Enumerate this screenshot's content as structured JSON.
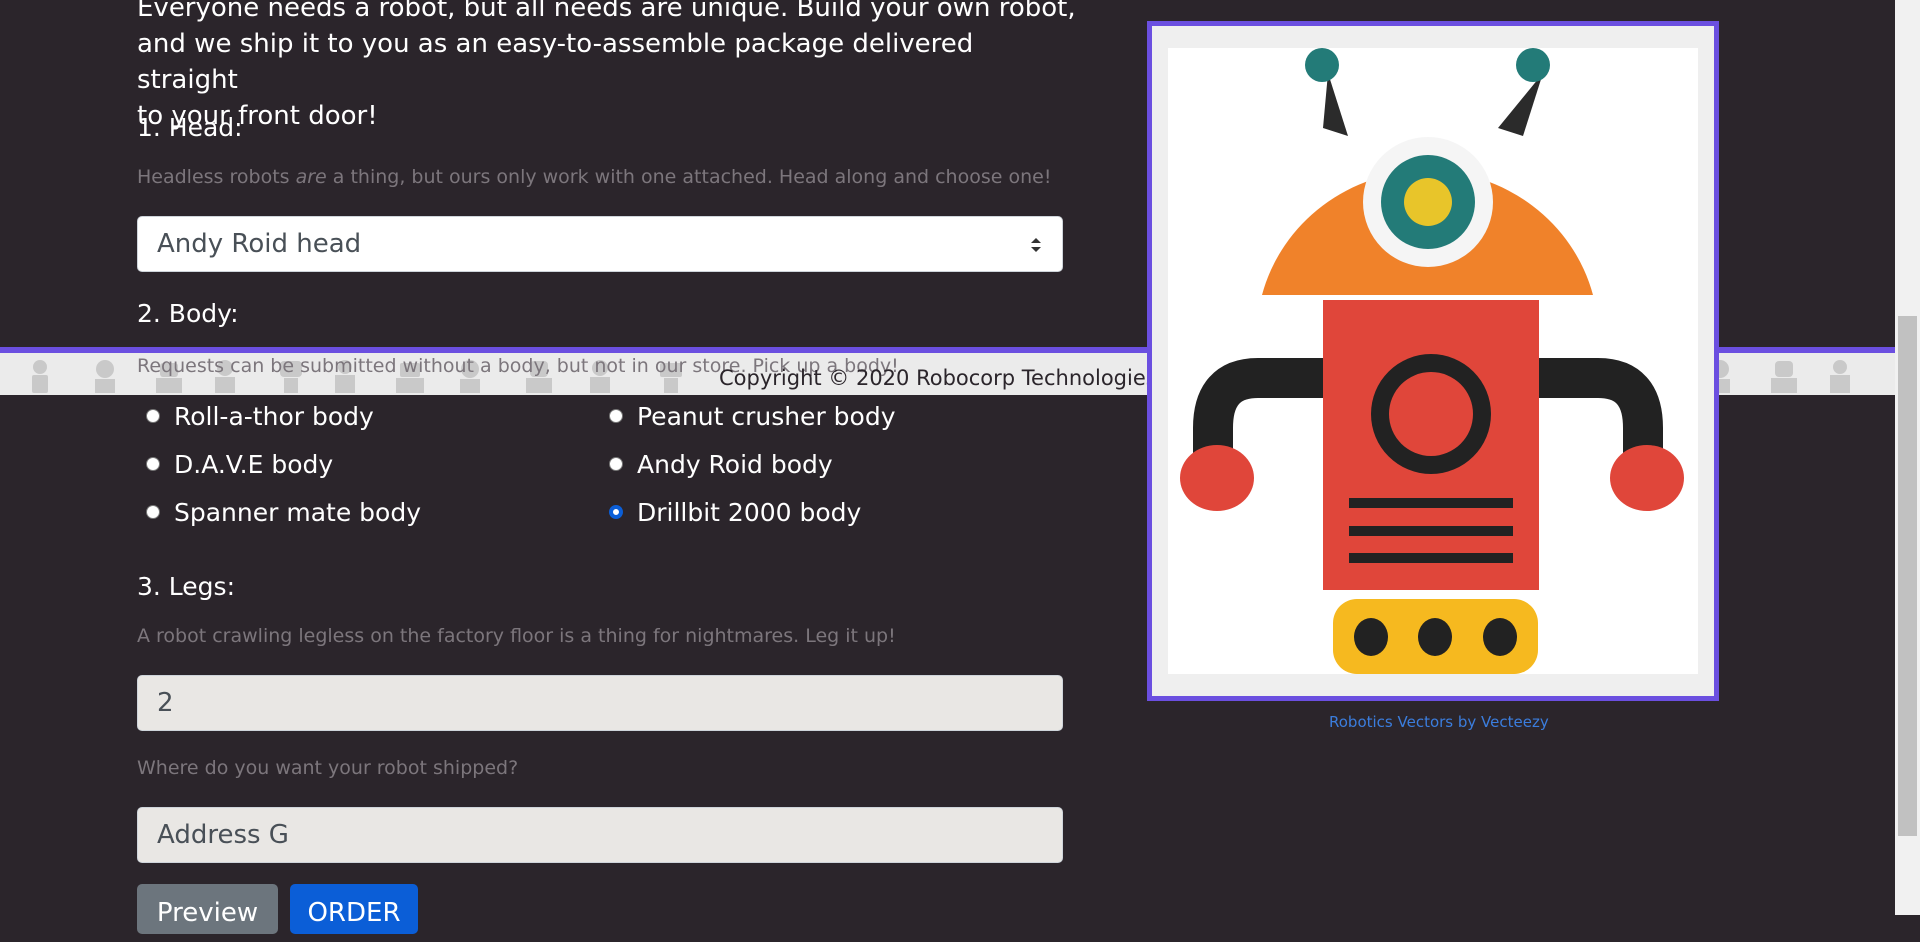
{
  "intro": {
    "line1": "Everyone needs a robot, but all needs are unique. Build your own robot,",
    "line2": "and we ship it to you as an easy-to-assemble package delivered straight",
    "line3": "to your front door!"
  },
  "head": {
    "heading": "1. Head:",
    "help_before": "Headless robots ",
    "help_em": "are",
    "help_after": " a thing, but ours only work with one attached. Head along and choose one!",
    "selected": "Andy Roid head"
  },
  "body": {
    "heading": "2. Body:",
    "help": "Requests can be submitted without a body, but not in our store. Pick up a body!",
    "options": [
      {
        "label": "Roll-a-thor body",
        "checked": false
      },
      {
        "label": "Peanut crusher body",
        "checked": false
      },
      {
        "label": "D.A.V.E body",
        "checked": false
      },
      {
        "label": "Andy Roid body",
        "checked": false
      },
      {
        "label": "Spanner mate body",
        "checked": false
      },
      {
        "label": "Drillbit 2000 body",
        "checked": true
      }
    ]
  },
  "legs": {
    "heading": "3. Legs:",
    "help": "A robot crawling legless on the factory floor is a thing for nightmares. Leg it up!",
    "value": "2"
  },
  "address": {
    "help": "Where do you want your robot shipped?",
    "value": "Address G"
  },
  "buttons": {
    "preview": "Preview",
    "order": "ORDER"
  },
  "footer": {
    "copyright": "Copyright © 2020 Robocorp Technologies, Inc."
  },
  "credit": "Robotics Vectors by Vecteezy",
  "colors": {
    "background": "#2b252b",
    "accent": "#6b4fe0",
    "primary": "#0b5ed7",
    "robot_head": "#f0822a",
    "robot_body": "#e0463a",
    "robot_eye": "#237b78",
    "robot_feet": "#f6b91f"
  }
}
